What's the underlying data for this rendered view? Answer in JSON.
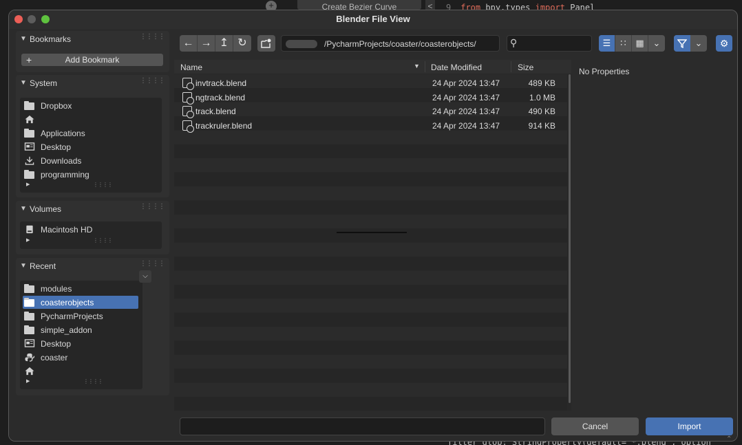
{
  "window": {
    "title": "Blender File View"
  },
  "background": {
    "top_button": "Create Bezier Curve",
    "top_plus": "+",
    "top_arrow": "<",
    "code_line_number": "9",
    "code_keyword_from": "from",
    "code_module": "bpy.types",
    "code_keyword_import": "import",
    "code_name": "Panel",
    "code_bottom": "filter_glob: StringProperty(default=\"*.blend\", option"
  },
  "sidebar": {
    "bookmarks": {
      "title": "Bookmarks",
      "add_label": "Add Bookmark"
    },
    "system": {
      "title": "System",
      "items": [
        {
          "label": "Dropbox",
          "icon": "folder-icon"
        },
        {
          "label": "",
          "icon": "home-icon"
        },
        {
          "label": "Applications",
          "icon": "folder-icon"
        },
        {
          "label": "Desktop",
          "icon": "desktop-icon"
        },
        {
          "label": "Downloads",
          "icon": "download-icon"
        },
        {
          "label": "programming",
          "icon": "folder-icon"
        }
      ]
    },
    "volumes": {
      "title": "Volumes",
      "items": [
        {
          "label": "Macintosh HD",
          "icon": "disk-icon"
        }
      ]
    },
    "recent": {
      "title": "Recent",
      "items": [
        {
          "label": "modules",
          "icon": "folder-icon"
        },
        {
          "label": "coasterobjects",
          "icon": "folder-icon",
          "selected": true
        },
        {
          "label": "PycharmProjects",
          "icon": "folder-icon"
        },
        {
          "label": "simple_addon",
          "icon": "folder-icon"
        },
        {
          "label": "Desktop",
          "icon": "desktop-icon"
        },
        {
          "label": "coaster",
          "icon": "python-icon"
        },
        {
          "label": "",
          "icon": "home-icon"
        }
      ]
    }
  },
  "toolbar": {
    "path": "/PycharmProjects/coaster/coasterobjects/",
    "search_placeholder": ""
  },
  "file_list": {
    "columns": {
      "name": "Name",
      "date": "Date Modified",
      "size": "Size"
    },
    "rows": [
      {
        "name": "invtrack.blend",
        "date": "24 Apr 2024 13:47",
        "size": "489 KB"
      },
      {
        "name": "ngtrack.blend",
        "date": "24 Apr 2024 13:47",
        "size": "1.0 MB"
      },
      {
        "name": "track.blend",
        "date": "24 Apr 2024 13:47",
        "size": "490 KB"
      },
      {
        "name": "trackruler.blend",
        "date": "24 Apr 2024 13:47",
        "size": "914 KB"
      }
    ]
  },
  "properties": {
    "empty_label": "No Properties"
  },
  "footer": {
    "filename_value": "",
    "cancel_label": "Cancel",
    "import_label": "Import"
  },
  "colors": {
    "accent": "#4772b3",
    "close": "#ec5f57",
    "maximize": "#5fc23f"
  }
}
